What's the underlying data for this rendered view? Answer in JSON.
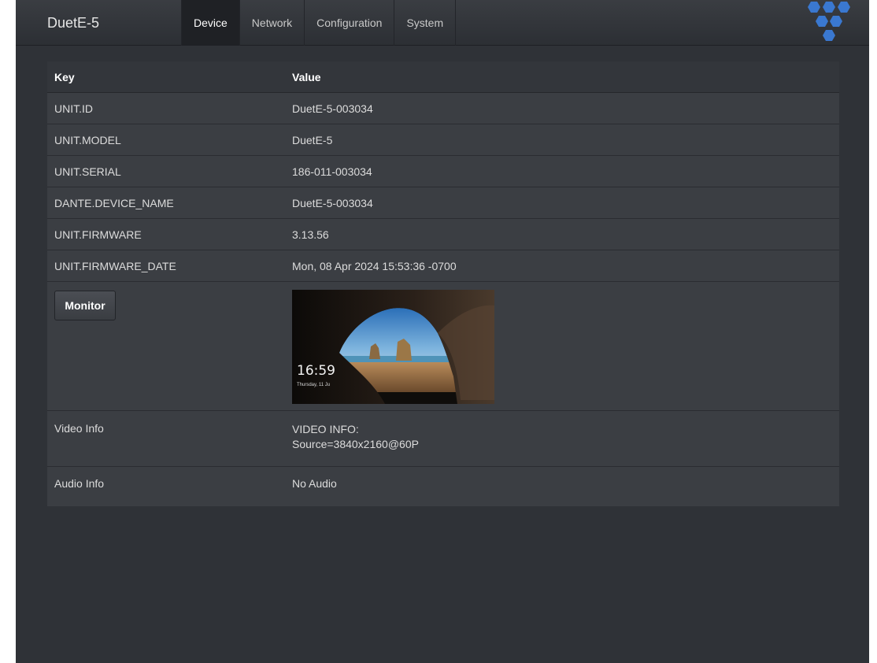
{
  "app": {
    "brand": "DuetE-5",
    "tabs": [
      {
        "label": "Device",
        "active": true
      },
      {
        "label": "Network",
        "active": false
      },
      {
        "label": "Configuration",
        "active": false
      },
      {
        "label": "System",
        "active": false
      }
    ],
    "logo_icon": "hexagon-cluster-logo",
    "logo_color": "#3a78d0"
  },
  "table": {
    "headers": {
      "key": "Key",
      "value": "Value"
    },
    "rows": [
      {
        "key": "UNIT.ID",
        "value": "DuetE-5-003034"
      },
      {
        "key": "UNIT.MODEL",
        "value": "DuetE-5"
      },
      {
        "key": "UNIT.SERIAL",
        "value": "186-011-003034"
      },
      {
        "key": "DANTE.DEVICE_NAME",
        "value": "DuetE-5-003034"
      },
      {
        "key": "UNIT.FIRMWARE",
        "value": "3.13.56"
      },
      {
        "key": "UNIT.FIRMWARE_DATE",
        "value": "Mon, 08 Apr 2024 15:53:36 -0700"
      }
    ],
    "monitor": {
      "button_label": "Monitor",
      "preview_clock": "16:59",
      "preview_date": "Thursday, 11 Ju"
    },
    "video_info": {
      "key": "Video Info",
      "line1": "VIDEO INFO:",
      "line2": "Source=3840x2160@60P"
    },
    "audio_info": {
      "key": "Audio Info",
      "value": "No Audio"
    }
  }
}
